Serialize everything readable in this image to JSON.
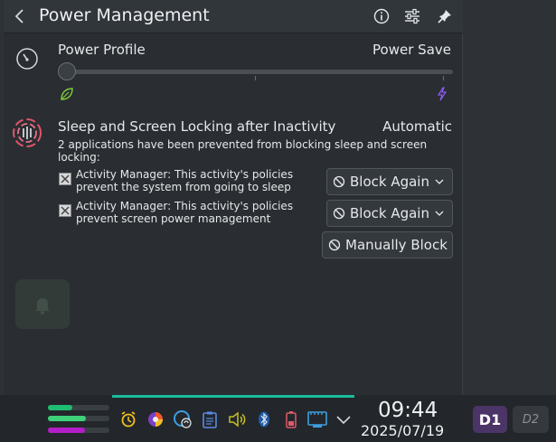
{
  "header": {
    "title": "Power Management",
    "back_icon": "chevron-left-icon",
    "info_icon": "info-icon",
    "config_icon": "sliders-icon",
    "pin_icon": "pin-icon"
  },
  "power_profile": {
    "label": "Power Profile",
    "value": "Power Save",
    "slider_level": 0,
    "slider_steps": 3,
    "left_icon": "leaf-icon",
    "right_icon": "lightning-icon"
  },
  "sleep": {
    "label": "Sleep and Screen Locking after Inactivity",
    "value": "Automatic",
    "description": "2 applications have been prevented from blocking sleep and screen locking:",
    "inhibitions": [
      {
        "text": "Activity Manager: This activity's policies prevent the system from going to sleep",
        "button": "Block Again"
      },
      {
        "text": "Activity Manager: This activity's policies prevent screen power management",
        "button": "Block Again"
      }
    ],
    "manual_button": "Manually Block"
  },
  "panel": {
    "meters": [
      {
        "level": 0.4,
        "color": "#1dbf73"
      },
      {
        "level": 0.62,
        "color": "#3fd07a"
      },
      {
        "level": 0.6,
        "color": "#b41ec8"
      }
    ],
    "clock_time": "09:44",
    "clock_date": "2025/07/19",
    "desktops": [
      "D1",
      "D2"
    ]
  },
  "colors": {
    "accent": "#1abc9c",
    "active_desktop": "#4b3466"
  }
}
